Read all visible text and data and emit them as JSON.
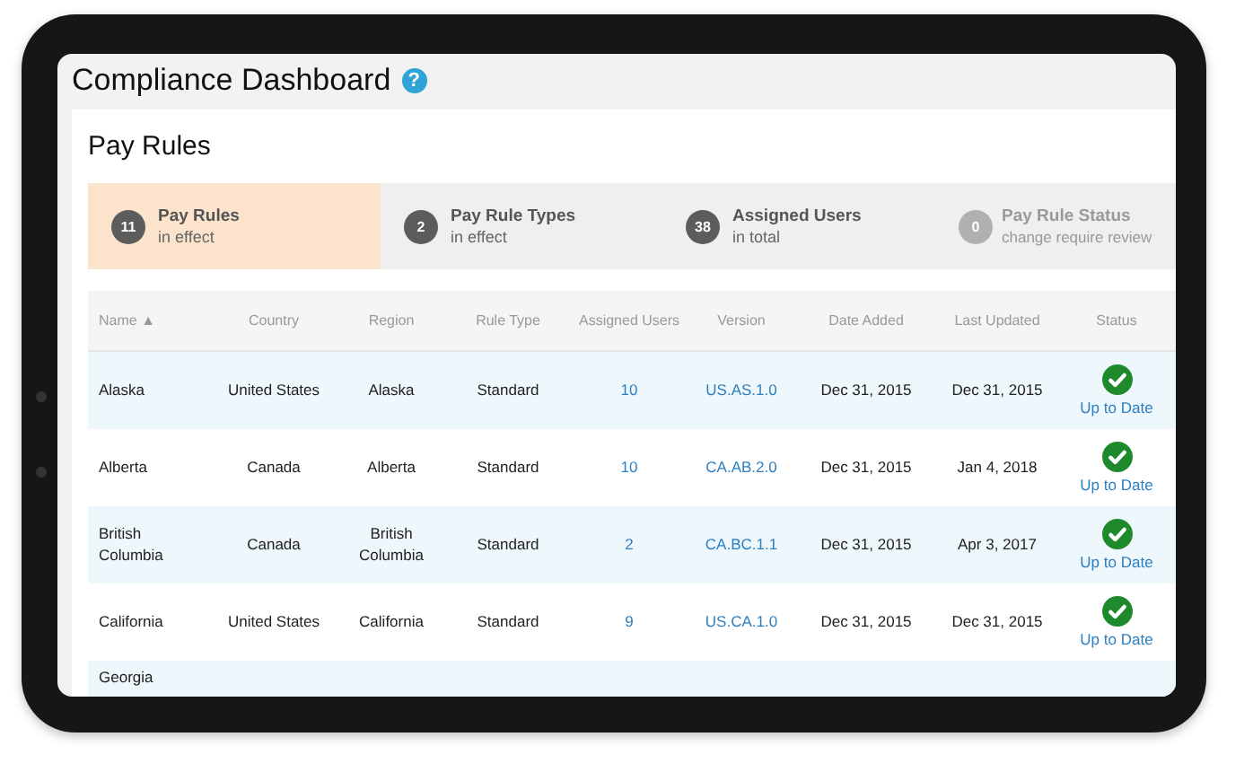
{
  "header": {
    "title": "Compliance Dashboard",
    "help_icon": "?"
  },
  "panel": {
    "title": "Pay Rules"
  },
  "summary": [
    {
      "count": "11",
      "label": "Pay Rules",
      "sub": "in effect",
      "selected": true,
      "disabled": false
    },
    {
      "count": "2",
      "label": "Pay Rule Types",
      "sub": "in effect",
      "selected": false,
      "disabled": false
    },
    {
      "count": "38",
      "label": "Assigned Users",
      "sub": "in total",
      "selected": false,
      "disabled": false
    },
    {
      "count": "0",
      "label": "Pay Rule Status",
      "sub": "change require review",
      "selected": false,
      "disabled": true
    }
  ],
  "table": {
    "columns": [
      {
        "label": "Name",
        "sort": "▲"
      },
      {
        "label": "Country"
      },
      {
        "label": "Region"
      },
      {
        "label": "Rule Type"
      },
      {
        "label": "Assigned Users"
      },
      {
        "label": "Version"
      },
      {
        "label": "Date Added"
      },
      {
        "label": "Last Updated"
      },
      {
        "label": "Status"
      }
    ],
    "rows": [
      {
        "name": "Alaska",
        "country": "United States",
        "region": "Alaska",
        "rule_type": "Standard",
        "users": "10",
        "version": "US.AS.1.0",
        "added": "Dec 31, 2015",
        "updated": "Dec 31, 2015",
        "status": {
          "kind": "ok",
          "label": "Up to Date"
        }
      },
      {
        "name": "Alberta",
        "country": "Canada",
        "region": "Alberta",
        "rule_type": "Standard",
        "users": "10",
        "version": "CA.AB.2.0",
        "added": "Dec 31, 2015",
        "updated": "Jan 4, 2018",
        "status": {
          "kind": "ok",
          "label": "Up to Date"
        }
      },
      {
        "name": "British Columbia",
        "country": "Canada",
        "region": "British Columbia",
        "rule_type": "Standard",
        "users": "2",
        "version": "CA.BC.1.1",
        "added": "Dec 31, 2015",
        "updated": "Apr 3, 2017",
        "status": {
          "kind": "ok",
          "label": "Up to Date"
        }
      },
      {
        "name": "California",
        "country": "United States",
        "region": "California",
        "rule_type": "Standard",
        "users": "9",
        "version": "US.CA.1.0",
        "added": "Dec 31, 2015",
        "updated": "Dec 31, 2015",
        "status": {
          "kind": "ok",
          "label": "Up to Date"
        }
      },
      {
        "name": "Georgia"
      }
    ]
  }
}
